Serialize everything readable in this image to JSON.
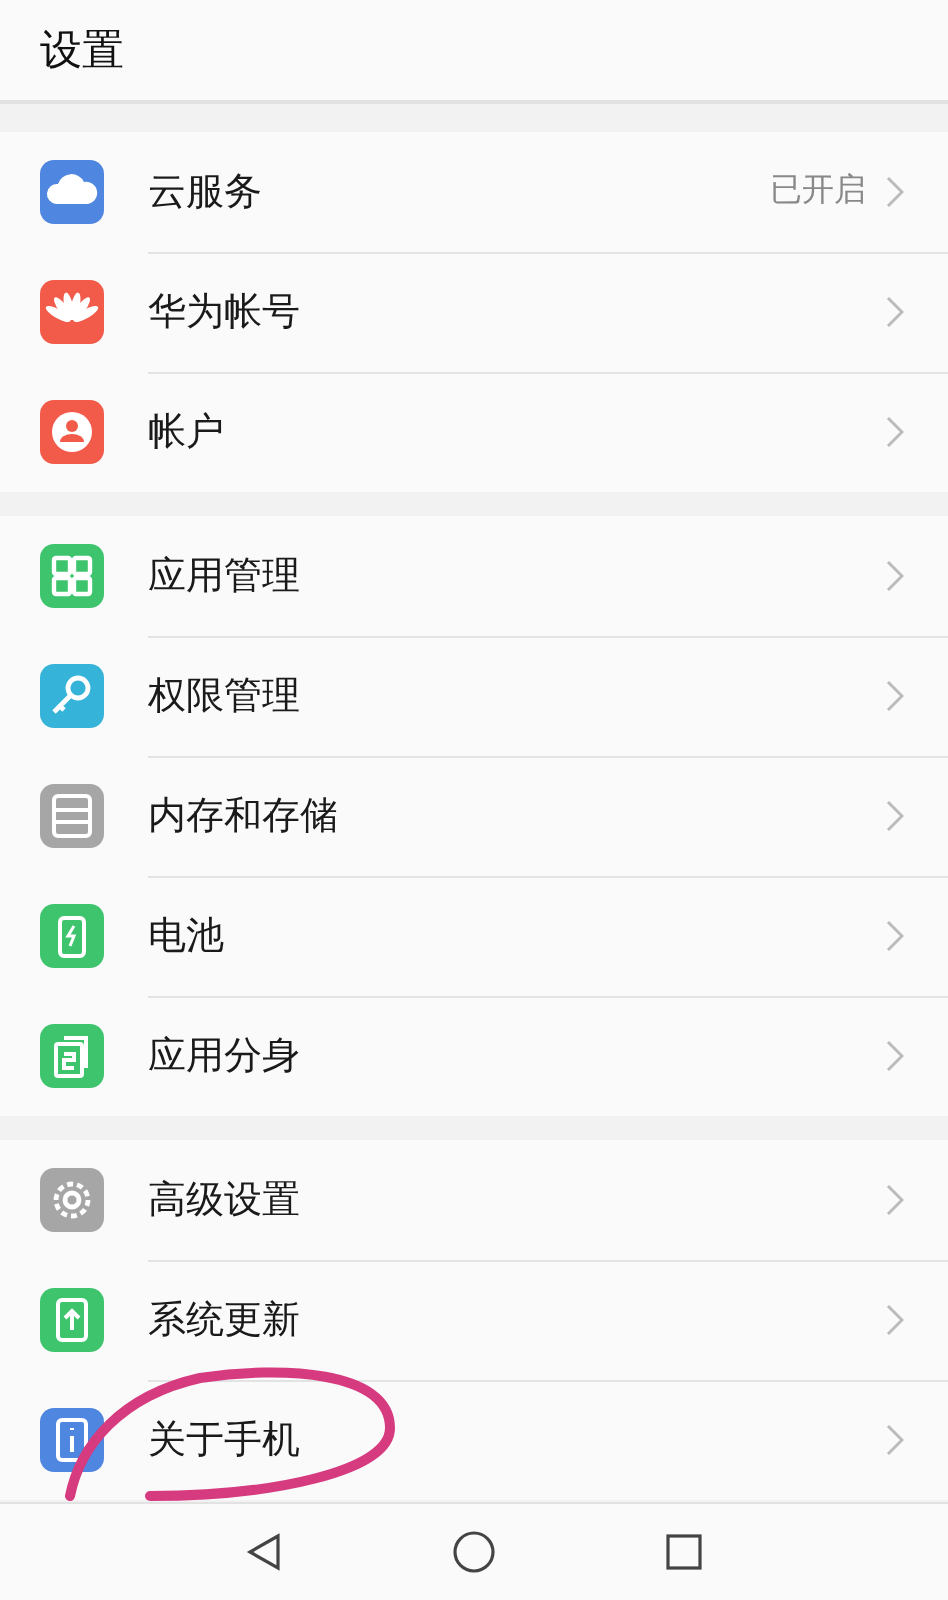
{
  "header": {
    "title": "设置"
  },
  "groups": [
    {
      "items": [
        {
          "label": "云服务",
          "value": "已开启",
          "color": "#4f86e0"
        },
        {
          "label": "华为帐号",
          "color": "#f25a4a"
        },
        {
          "label": "帐户",
          "color": "#f25a4a"
        }
      ]
    },
    {
      "items": [
        {
          "label": "应用管理",
          "color": "#3ec46d"
        },
        {
          "label": "权限管理",
          "color": "#35b3d9"
        },
        {
          "label": "内存和存储",
          "color": "#a6a6a6"
        },
        {
          "label": "电池",
          "color": "#3ec46d"
        },
        {
          "label": "应用分身",
          "color": "#3ec46d"
        }
      ]
    },
    {
      "items": [
        {
          "label": "高级设置",
          "color": "#a6a6a6"
        },
        {
          "label": "系统更新",
          "color": "#3ec46d"
        },
        {
          "label": "关于手机",
          "color": "#4f86e0"
        }
      ]
    }
  ]
}
